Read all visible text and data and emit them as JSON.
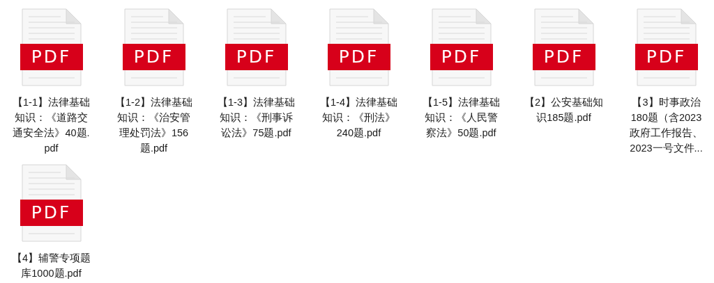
{
  "files": [
    {
      "badge": "PDF",
      "name_lines": [
        "【1-1】法律基础",
        "知识：《道路交",
        "通安全法》40题.",
        "pdf"
      ]
    },
    {
      "badge": "PDF",
      "name_lines": [
        "【1-2】法律基础",
        "知识：《治安管",
        "理处罚法》156",
        "题.pdf"
      ]
    },
    {
      "badge": "PDF",
      "name_lines": [
        "【1-3】法律基础",
        "知识：《刑事诉",
        "讼法》75题.pdf"
      ]
    },
    {
      "badge": "PDF",
      "name_lines": [
        "【1-4】法律基础",
        "知识：《刑法》",
        "240题.pdf"
      ]
    },
    {
      "badge": "PDF",
      "name_lines": [
        "【1-5】法律基础",
        "知识：《人民警",
        "察法》50题.pdf"
      ]
    },
    {
      "badge": "PDF",
      "name_lines": [
        "【2】公安基础知",
        "识185题.pdf"
      ]
    },
    {
      "badge": "PDF",
      "name_lines": [
        "【3】时事政治",
        "180题（含2023",
        "政府工作报告、",
        "2023一号文件..."
      ]
    },
    {
      "badge": "PDF",
      "name_lines": [
        "【4】辅警专项题",
        "库1000题.pdf"
      ]
    }
  ]
}
